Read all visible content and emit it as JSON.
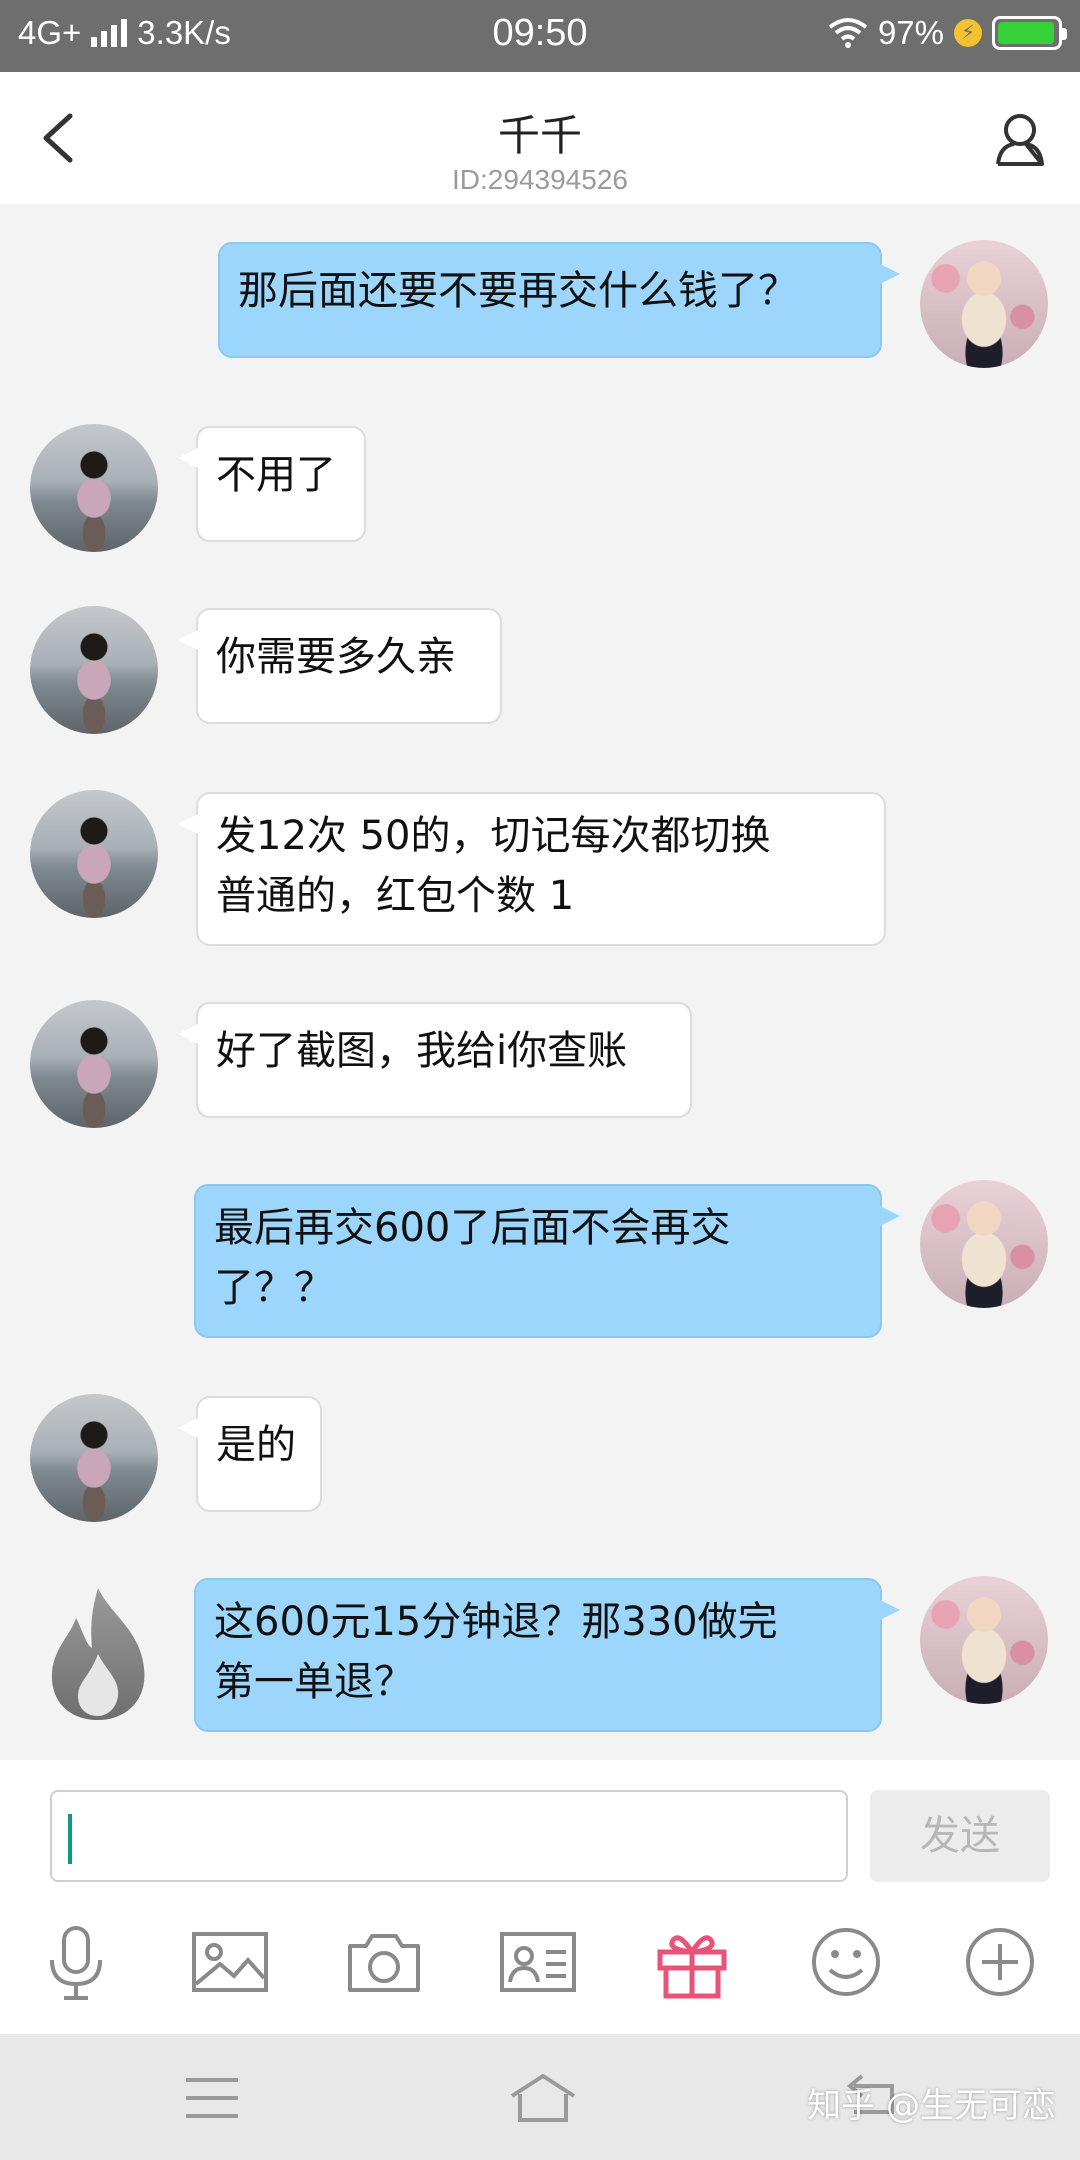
{
  "status_bar": {
    "network": "4G+",
    "speed": "3.3K/s",
    "time": "09:50",
    "battery_percent": "97%",
    "battery_level": 0.97
  },
  "header": {
    "title": "千千",
    "subtitle": "ID:294394526"
  },
  "messages": [
    {
      "side": "out",
      "text": "那后面还要不要再交什么钱了？"
    },
    {
      "side": "in",
      "text": "不用了"
    },
    {
      "side": "in",
      "text": "你需要多久亲"
    },
    {
      "side": "in",
      "line1": "发12次 50的，切记每次都切换",
      "line2": "普通的，红包个数 1"
    },
    {
      "side": "in",
      "text": "好了截图，我给i你查账"
    },
    {
      "side": "out",
      "line1": "最后再交600了后面不会再交",
      "line2": "了？？"
    },
    {
      "side": "in",
      "text": "是的"
    },
    {
      "side": "out",
      "line1": "这600元15分钟退？那330做完",
      "line2": "第一单退？"
    }
  ],
  "input": {
    "value": "",
    "send_label": "发送"
  },
  "toolbar": {
    "icons": [
      "microphone-icon",
      "image-icon",
      "camera-icon",
      "contact-card-icon",
      "gift-icon",
      "emoji-icon",
      "plus-icon"
    ],
    "gift_color": "#e8537a"
  },
  "nav": {
    "watermark": "知乎 @生无可恋"
  },
  "colors": {
    "outgoing_bubble": "#9dd6fd",
    "incoming_bubble": "#ffffff",
    "status_bar": "#6e6e6e"
  }
}
